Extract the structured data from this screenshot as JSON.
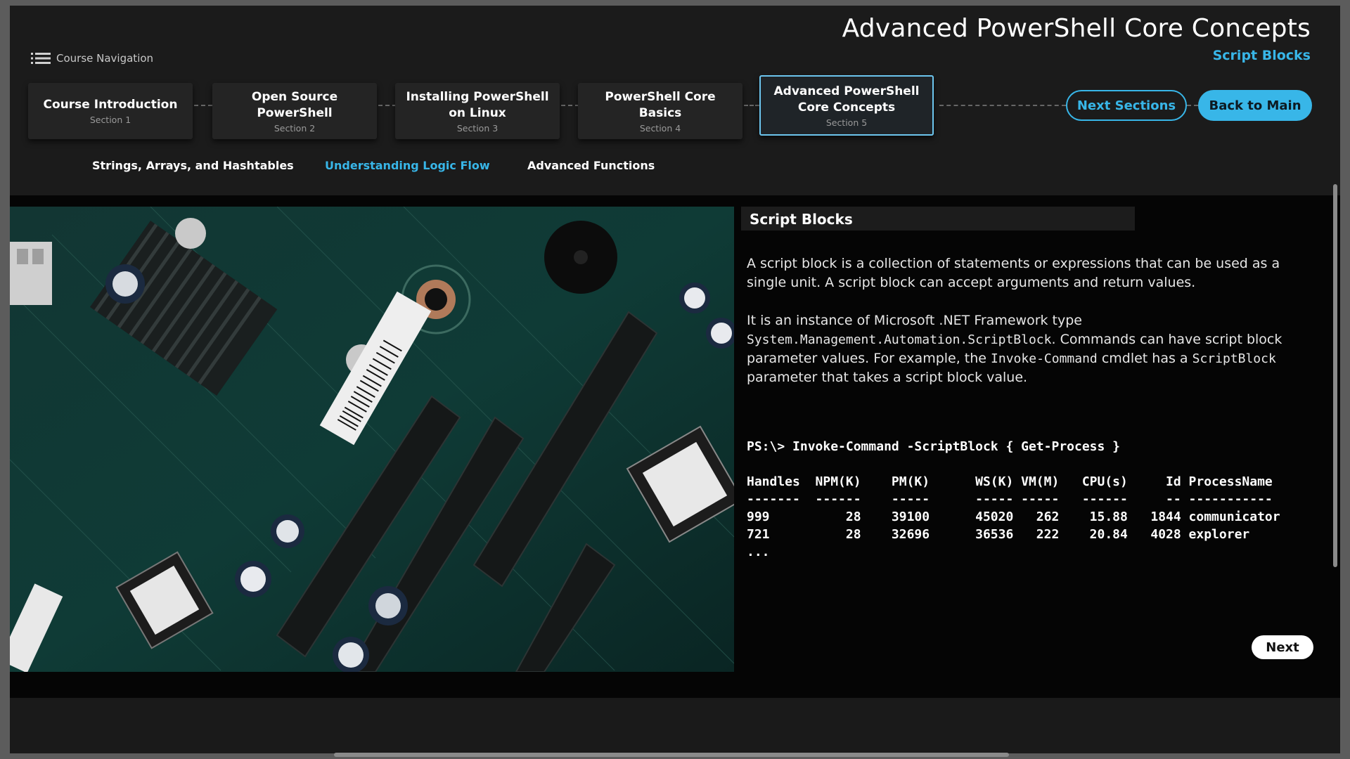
{
  "header": {
    "course_title": "Advanced PowerShell Core Concepts",
    "current_topic": "Script Blocks",
    "course_nav_label": "Course Navigation"
  },
  "sections": [
    {
      "name": "Course Introduction",
      "number": "Section 1"
    },
    {
      "name": "Open Source PowerShell",
      "number": "Section 2"
    },
    {
      "name": "Installing PowerShell on Linux",
      "number": "Section 3"
    },
    {
      "name": "PowerShell Core Basics",
      "number": "Section 4"
    },
    {
      "name": "Advanced PowerShell Core Concepts",
      "number": "Section 5"
    }
  ],
  "buttons": {
    "next_sections": "Next Sections",
    "back_to_main": "Back to Main",
    "next": "Next"
  },
  "subtabs": [
    "Strings, Arrays, and Hashtables",
    "Understanding Logic Flow",
    "Advanced Functions"
  ],
  "topic": {
    "title": "Script Blocks",
    "para1": "A script block is a collection of statements or expressions that can be used as a single unit. A script block can accept arguments and return values.",
    "para2_a": "It is an instance of Microsoft .NET Framework type",
    "para2_code1": "System.Management.Automation.ScriptBlock",
    "para2_b": ". Commands can have script block parameter values. For example, the",
    "para2_code2": "Invoke-Command",
    "para2_c": "cmdlet has a",
    "para2_code3": "ScriptBlock",
    "para2_d": "parameter that takes  a script block value."
  },
  "code": {
    "command": "PS:\\> Invoke-Command -ScriptBlock { Get-Process }",
    "header": "Handles  NPM(K)    PM(K)      WS(K) VM(M)   CPU(s)     Id ProcessName",
    "separator": "-------  ------    -----      ----- -----   ------     -- -----------",
    "row1": "999          28    39100      45020   262    15.88   1844 communicator",
    "row2": "721          28    32696      36536   222    20.84   4028 explorer",
    "ellipsis": "..."
  },
  "colors": {
    "accent": "#38b6e8",
    "background": "#1a1a1a",
    "content_bg": "#050505"
  }
}
